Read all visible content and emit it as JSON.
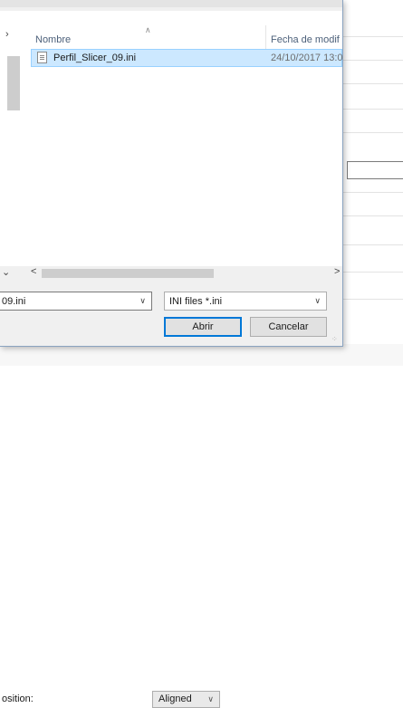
{
  "file_list": {
    "columns": [
      "Nombre",
      "Fecha de modif"
    ],
    "files": [
      {
        "name": "Perfil_Slicer_09.ini",
        "date": "24/10/2017 13:0",
        "selected": true
      }
    ]
  },
  "filename_field": {
    "value": "09.ini"
  },
  "filter": {
    "value": "INI files *.ini"
  },
  "buttons": {
    "open": "Abrir",
    "cancel": "Cancelar"
  },
  "background_window": {
    "label": "osition:",
    "select_value": "Aligned"
  },
  "colors": {
    "selection": "#cce8ff",
    "default_button_border": "#0078d7"
  }
}
